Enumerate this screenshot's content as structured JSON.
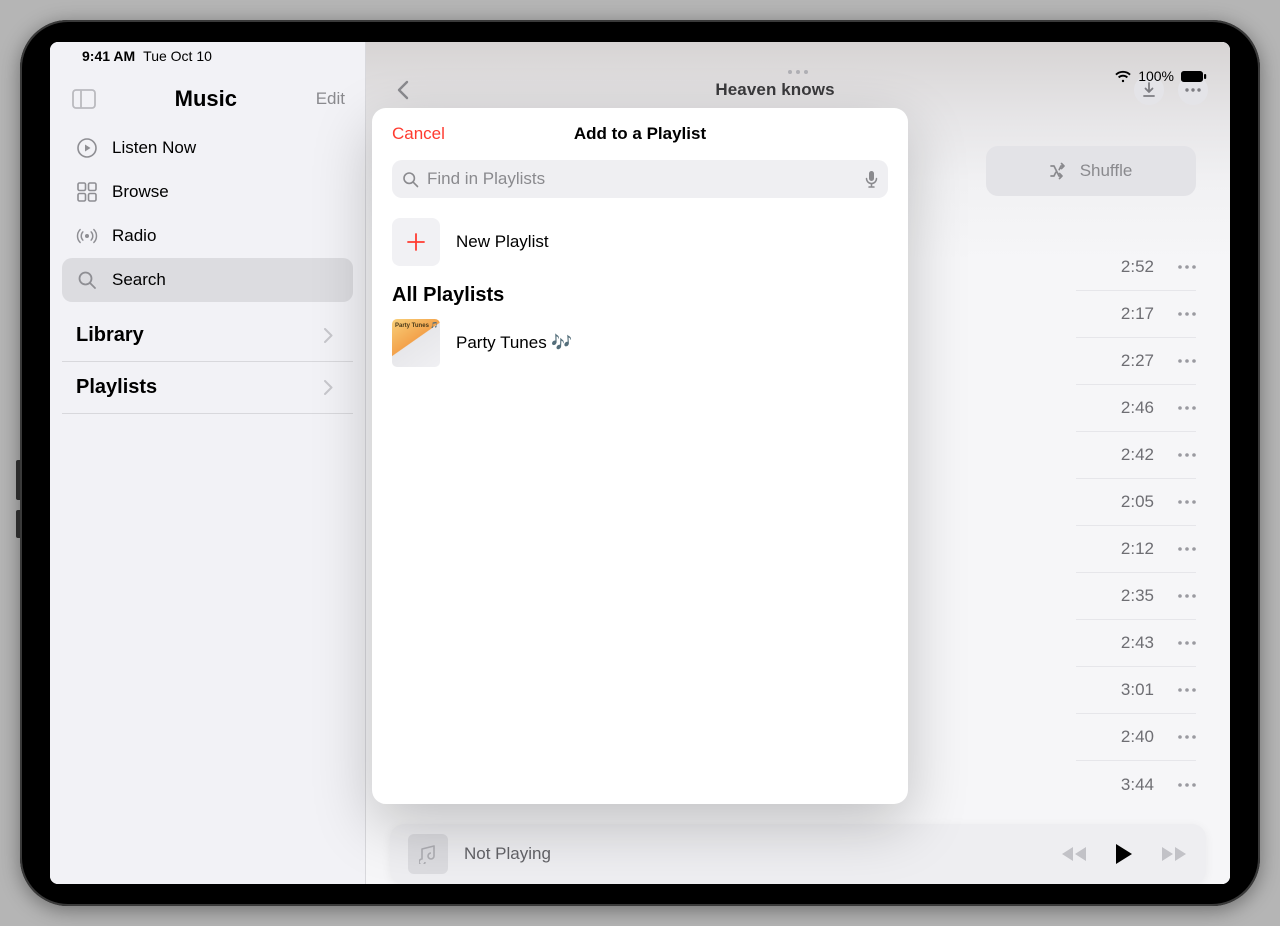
{
  "status": {
    "time": "9:41 AM",
    "date": "Tue Oct 10",
    "battery": "100%"
  },
  "sidebar": {
    "title": "Music",
    "edit": "Edit",
    "items": [
      {
        "label": "Listen Now",
        "icon": "play-circle"
      },
      {
        "label": "Browse",
        "icon": "grid"
      },
      {
        "label": "Radio",
        "icon": "radio"
      },
      {
        "label": "Search",
        "icon": "search",
        "active": true
      }
    ],
    "sections": [
      "Library",
      "Playlists"
    ]
  },
  "main": {
    "title": "Heaven knows",
    "shuffle": "Shuffle",
    "tracks": [
      "2:52",
      "2:17",
      "2:27",
      "2:46",
      "2:42",
      "2:05",
      "2:12",
      "2:35",
      "2:43",
      "3:01",
      "2:40",
      "3:44"
    ]
  },
  "now_playing": {
    "label": "Not Playing"
  },
  "modal": {
    "cancel": "Cancel",
    "title": "Add to a Playlist",
    "search_placeholder": "Find in Playlists",
    "new_playlist": "New Playlist",
    "section": "All Playlists",
    "playlists": [
      {
        "name": "Party Tunes 🎶"
      }
    ]
  }
}
